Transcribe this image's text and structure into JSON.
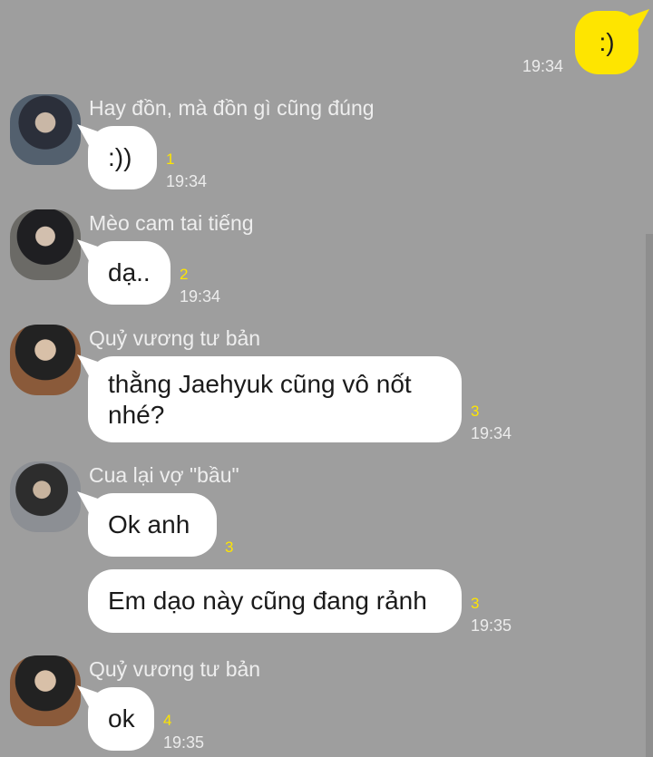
{
  "outgoing": {
    "text": ":)",
    "time": "19:34"
  },
  "messages": [
    {
      "sender": "Hay đồn, mà đồn gì cũng đúng",
      "text": ":))",
      "unread": "1",
      "time": "19:34"
    },
    {
      "sender": "Mèo cam tai tiếng",
      "text": "dạ..",
      "unread": "2",
      "time": "19:34"
    },
    {
      "sender": "Quỷ vương tư bản",
      "text_line1": "thằng Jaehyuk cũng vô nốt",
      "text_line2": "nhé?",
      "unread": "3",
      "time": "19:34"
    },
    {
      "sender": "Cua lại vợ \"bầu\"",
      "text": "Ok anh",
      "unread": "3"
    },
    {
      "text": "Em dạo này cũng đang rảnh",
      "unread": "3",
      "time": "19:35"
    },
    {
      "sender": "Quỷ vương tư bản",
      "text": "ok",
      "unread": "4",
      "time": "19:35"
    }
  ]
}
